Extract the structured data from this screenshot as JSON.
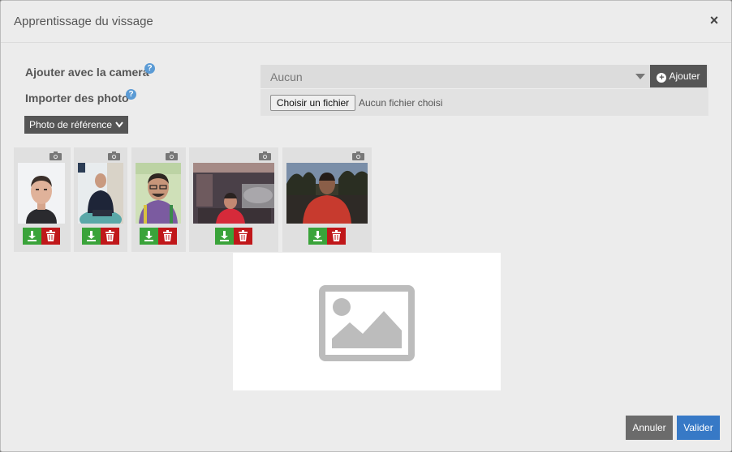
{
  "modal": {
    "title": "Apprentissage du vissage",
    "close_symbol": "×"
  },
  "form": {
    "camera_label": "Ajouter avec la camera",
    "import_label": "Importer des photo",
    "help_symbol": "?",
    "reference_button": "Photo de référence",
    "camera_select_value": "Aucun",
    "add_button": "Ajouter",
    "file_button": "Choisir un fichier",
    "file_status": "Aucun fichier choisi"
  },
  "photos": [
    {
      "icon": "camera-icon",
      "actions": [
        "download-icon",
        "trash-icon"
      ]
    },
    {
      "icon": "camera-icon",
      "actions": [
        "download-icon",
        "trash-icon"
      ]
    },
    {
      "icon": "camera-icon",
      "actions": [
        "download-icon",
        "trash-icon"
      ]
    },
    {
      "icon": "camera-icon",
      "actions": [
        "download-icon",
        "trash-icon"
      ]
    },
    {
      "icon": "camera-icon",
      "actions": [
        "download-icon",
        "trash-icon"
      ]
    }
  ],
  "preview": {
    "icon": "image-placeholder-icon"
  },
  "footer": {
    "cancel_button": "Annuler",
    "ok_button": "Valider"
  },
  "colors": {
    "download": "#3aa33a",
    "delete": "#c0171a",
    "primary": "#3779c6",
    "dark": "#555555"
  }
}
